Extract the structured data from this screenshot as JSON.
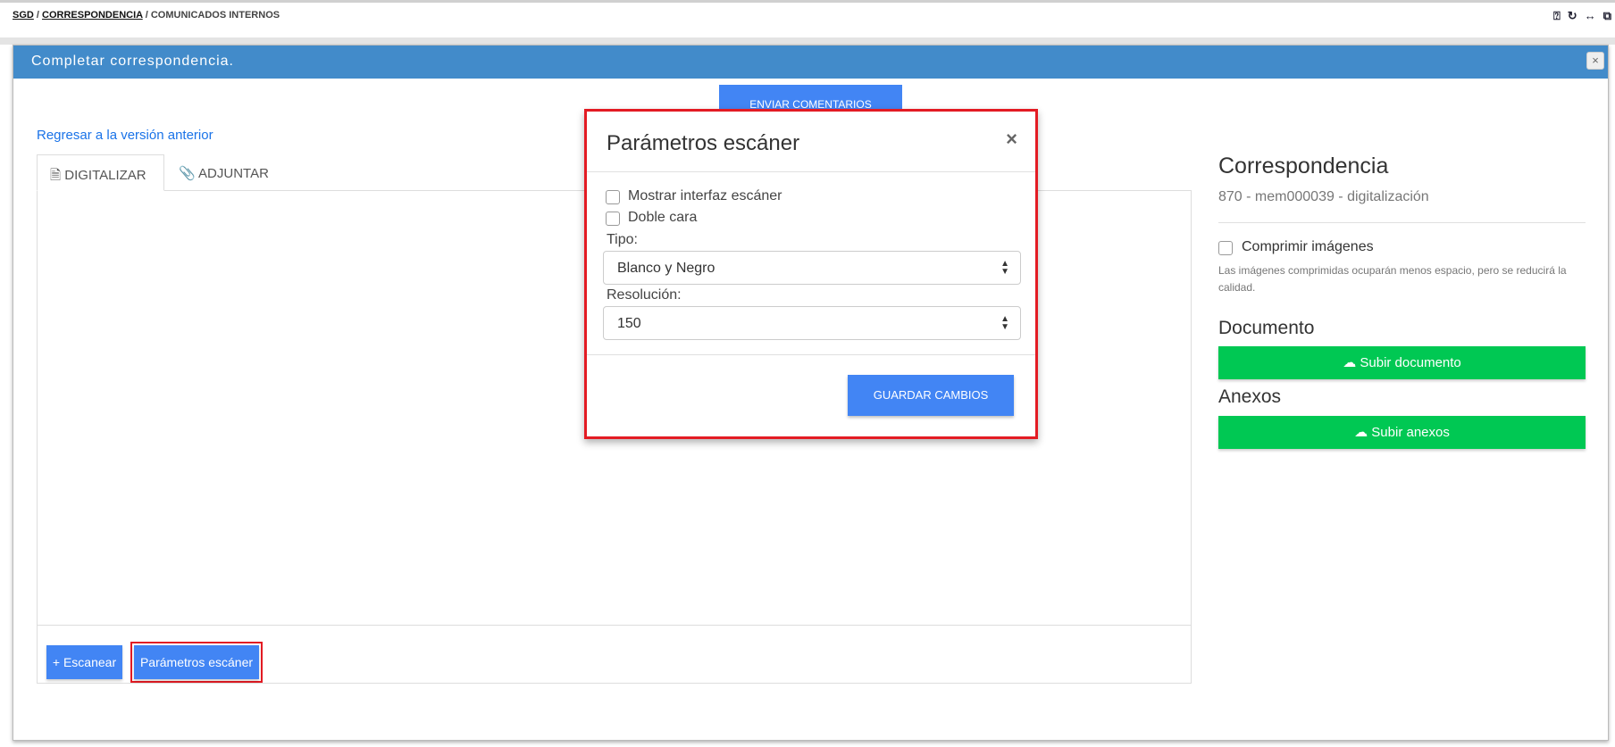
{
  "breadcrumb": [
    "SGD",
    "CORRESPONDENCIA",
    "COMUNICADOS INTERNOS"
  ],
  "toolbar_icons": [
    "help-icon",
    "refresh-icon",
    "split-icon",
    "restore-icon"
  ],
  "window": {
    "title": "Completar correspondencia.",
    "close": "×"
  },
  "enviar_label": "ENVIAR COMENTARIOS",
  "regresar_link": "Regresar a la versión anterior",
  "tabs": [
    {
      "label": "DIGITALIZAR",
      "icon": "file-icon"
    },
    {
      "label": "ADJUNTAR",
      "icon": "paperclip-icon"
    }
  ],
  "footer_buttons": {
    "scan": "+ Escanear",
    "params": "Parámetros escáner"
  },
  "right": {
    "title": "Correspondencia",
    "subtitle": "870 - mem000039 - digitalización",
    "compress_label": "Comprimir imágenes",
    "compress_help": "Las imágenes comprimidas ocuparán menos espacio, pero se reducirá la calidad.",
    "doc_heading": "Documento",
    "doc_button": "Subir documento",
    "anex_heading": "Anexos",
    "anex_button": "Subir anexos"
  },
  "dialog": {
    "title": "Parámetros escáner",
    "close": "×",
    "show_ui": "Mostrar interfaz escáner",
    "duplex": "Doble cara",
    "tipo_label": "Tipo:",
    "tipo_value": "Blanco y Negro",
    "res_label": "Resolución:",
    "res_value": "150",
    "save": "GUARDAR CAMBIOS"
  },
  "colors": {
    "header": "#428bca",
    "primary": "#4285f4",
    "success": "#00c853",
    "highlight": "#e31b23"
  }
}
